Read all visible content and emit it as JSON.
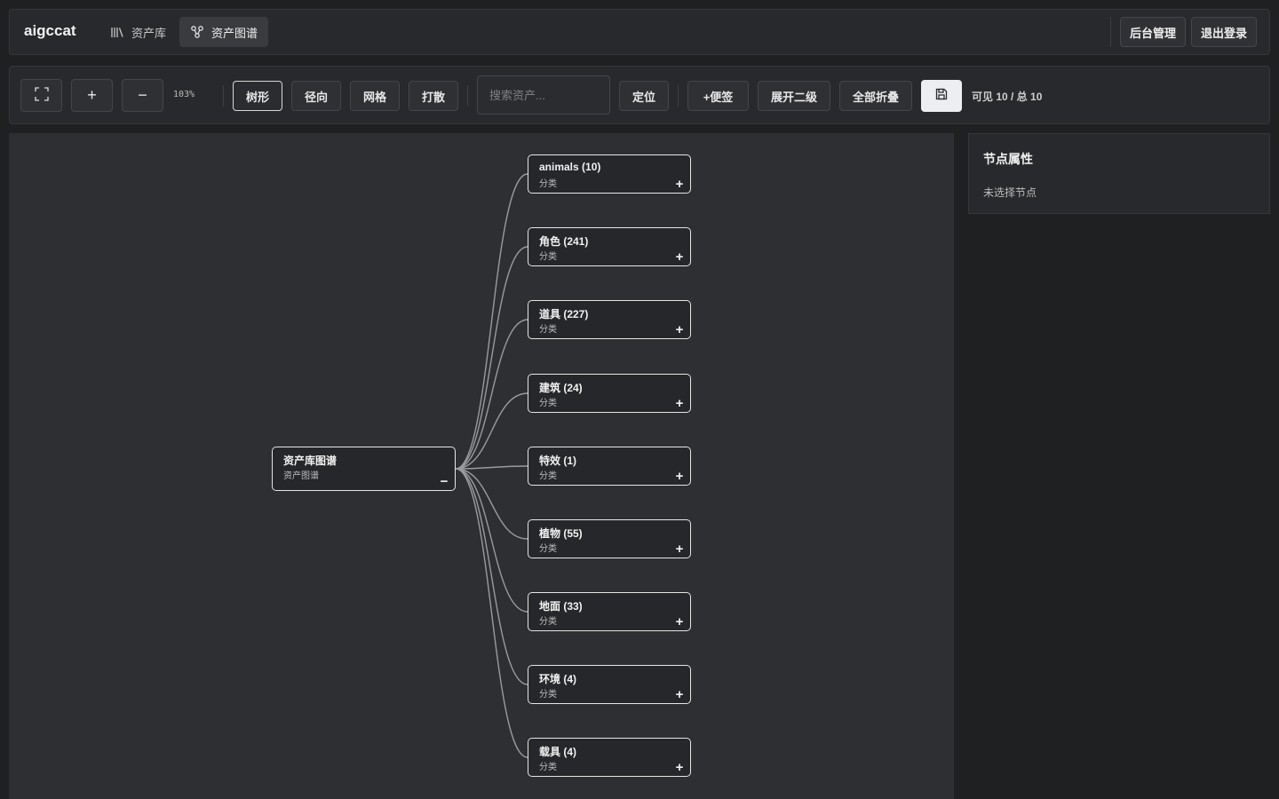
{
  "header": {
    "brand": "aigccat",
    "nav": [
      {
        "label": "资产库",
        "icon": "library-icon",
        "active": false
      },
      {
        "label": "资产图谱",
        "icon": "graph-icon",
        "active": true
      }
    ],
    "admin_label": "后台管理",
    "logout_label": "退出登录"
  },
  "toolbar": {
    "fit_icon": "fit-screen-icon",
    "zoom_in_label": "+",
    "zoom_out_label": "−",
    "zoom_level": "103%",
    "layouts": [
      "树形",
      "径向",
      "网格",
      "打散"
    ],
    "selected_layout": "树形",
    "search_placeholder": "搜索资产...",
    "locate_label": "定位",
    "add_note_label": "+便签",
    "expand_label": "展开二级",
    "collapse_label": "全部折叠",
    "save_icon": "save-icon",
    "count_text": "可见 10 / 总 10"
  },
  "graph": {
    "root": {
      "title": "资产库图谱",
      "subtitle": "资产图谱",
      "toggle": "−"
    },
    "children": [
      {
        "title": "animals (10)",
        "subtitle": "分类",
        "toggle": "+"
      },
      {
        "title": "角色 (241)",
        "subtitle": "分类",
        "toggle": "+"
      },
      {
        "title": "道具 (227)",
        "subtitle": "分类",
        "toggle": "+"
      },
      {
        "title": "建筑 (24)",
        "subtitle": "分类",
        "toggle": "+"
      },
      {
        "title": "特效 (1)",
        "subtitle": "分类",
        "toggle": "+"
      },
      {
        "title": "植物 (55)",
        "subtitle": "分类",
        "toggle": "+"
      },
      {
        "title": "地面 (33)",
        "subtitle": "分类",
        "toggle": "+"
      },
      {
        "title": "环境 (4)",
        "subtitle": "分类",
        "toggle": "+"
      },
      {
        "title": "载具 (4)",
        "subtitle": "分类",
        "toggle": "+"
      }
    ],
    "edge_color": "#9a9ba0"
  },
  "panel": {
    "title": "节点属性",
    "empty_text": "未选择节点"
  }
}
